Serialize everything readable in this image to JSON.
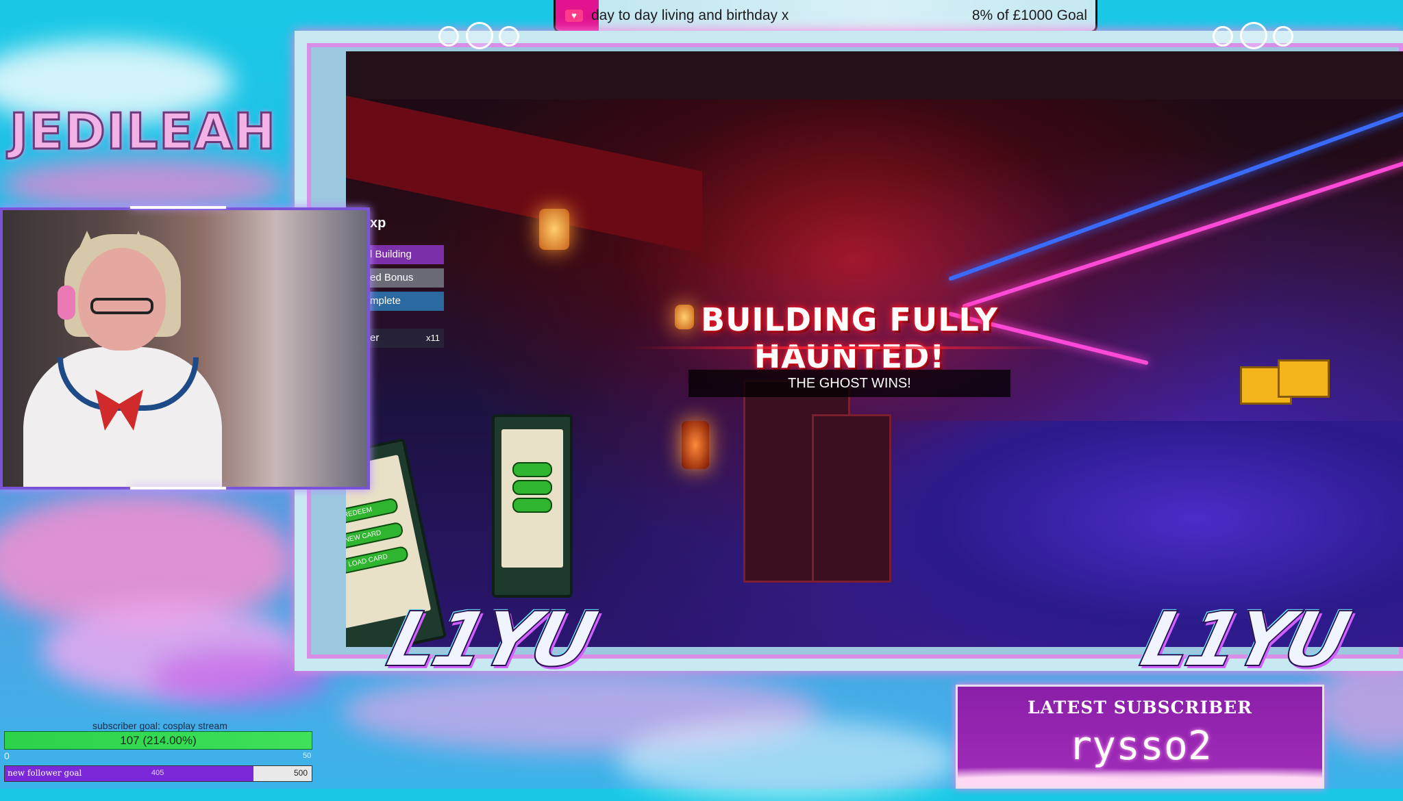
{
  "donation_goal": {
    "icon": "heart-cup-icon",
    "title": "day to day living and birthday x",
    "progress_text": "8% of £1000 Goal",
    "progress_fraction": 0.08,
    "accent_color": "#e0148f"
  },
  "channel_logo": {
    "text": "JEDILEAH"
  },
  "game": {
    "hud": {
      "header": "xp",
      "rows": [
        "l Building",
        "ed Bonus",
        "mplete",
        "er"
      ],
      "multiplier": "x11"
    },
    "banner_title": "BUILDING FULLY HAUNTED!",
    "banner_subtitle": "THE GHOST WINS!",
    "kiosk_left_buttons": [
      "REDEEM",
      "NEW CARD",
      "LOAD CARD"
    ]
  },
  "brand_marks": {
    "left": "L1YU",
    "right": "L1YU"
  },
  "subscriber_goal": {
    "label": "subscriber goal: cosplay stream",
    "value_text": "107 (214.00%)",
    "min": "0",
    "max": "50",
    "progress_fraction": 1.0,
    "color": "#2bd34a"
  },
  "follower_goal": {
    "label": "new follower goal",
    "current": "405",
    "target": "500",
    "progress_fraction": 0.81,
    "color": "#7a28d8"
  },
  "latest_subscriber": {
    "title": "LATEST SUBSCRIBER",
    "name": "rysso2"
  }
}
